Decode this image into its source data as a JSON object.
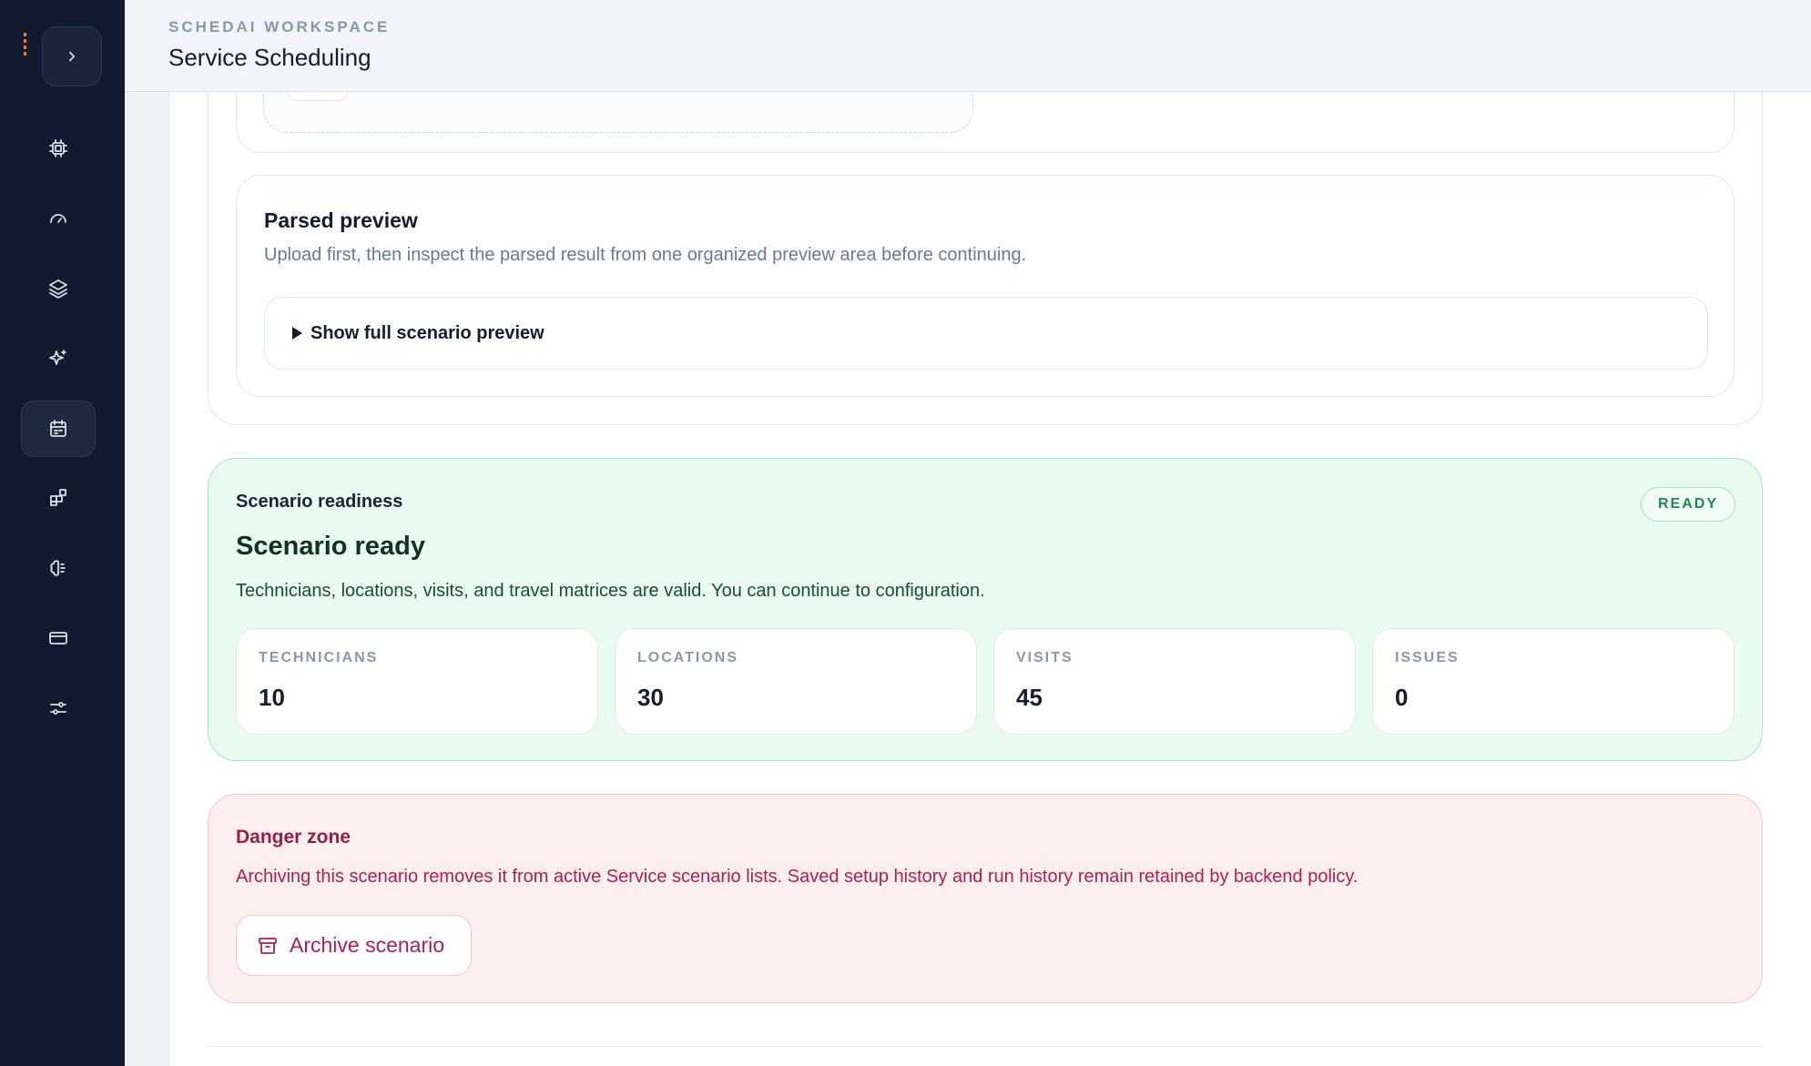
{
  "header": {
    "eyebrow": "SCHEDAI WORKSPACE",
    "title": "Service Scheduling"
  },
  "sidebar": {
    "toggle_icon": "chevron-right-icon",
    "items": [
      {
        "icon": "cpu-icon",
        "active": false
      },
      {
        "icon": "gauge-icon",
        "active": false
      },
      {
        "icon": "layers-icon",
        "active": false
      },
      {
        "icon": "sparkles-icon",
        "active": false
      },
      {
        "icon": "calendar-icon",
        "active": true
      },
      {
        "icon": "blocks-icon",
        "active": false
      },
      {
        "icon": "brain-icon",
        "active": false
      },
      {
        "icon": "credit-card-icon",
        "active": false
      },
      {
        "icon": "sliders-icon",
        "active": false
      }
    ]
  },
  "preview": {
    "title": "Parsed preview",
    "subtitle": "Upload first, then inspect the parsed result from one organized preview area before continuing.",
    "toggle_label": "Show full scenario preview"
  },
  "readiness": {
    "eyebrow": "Scenario readiness",
    "title": "Scenario ready",
    "description": "Technicians, locations, visits, and travel matrices are valid. You can continue to configuration.",
    "badge": "READY",
    "stats": [
      {
        "label": "TECHNICIANS",
        "value": "10"
      },
      {
        "label": "LOCATIONS",
        "value": "30"
      },
      {
        "label": "VISITS",
        "value": "45"
      },
      {
        "label": "ISSUES",
        "value": "0"
      }
    ]
  },
  "danger": {
    "title": "Danger zone",
    "description": "Archiving this scenario removes it from active Service scenario lists. Saved setup history and run history remain retained by backend policy.",
    "button_label": "Archive scenario",
    "button_icon": "archive-icon"
  },
  "colors": {
    "sidebar_bg": "#111a2e",
    "ready_bg": "#e9fbf1",
    "ready_accent": "#1b8a57",
    "danger_bg": "#fdeef0",
    "danger_accent": "#b01f4e"
  }
}
